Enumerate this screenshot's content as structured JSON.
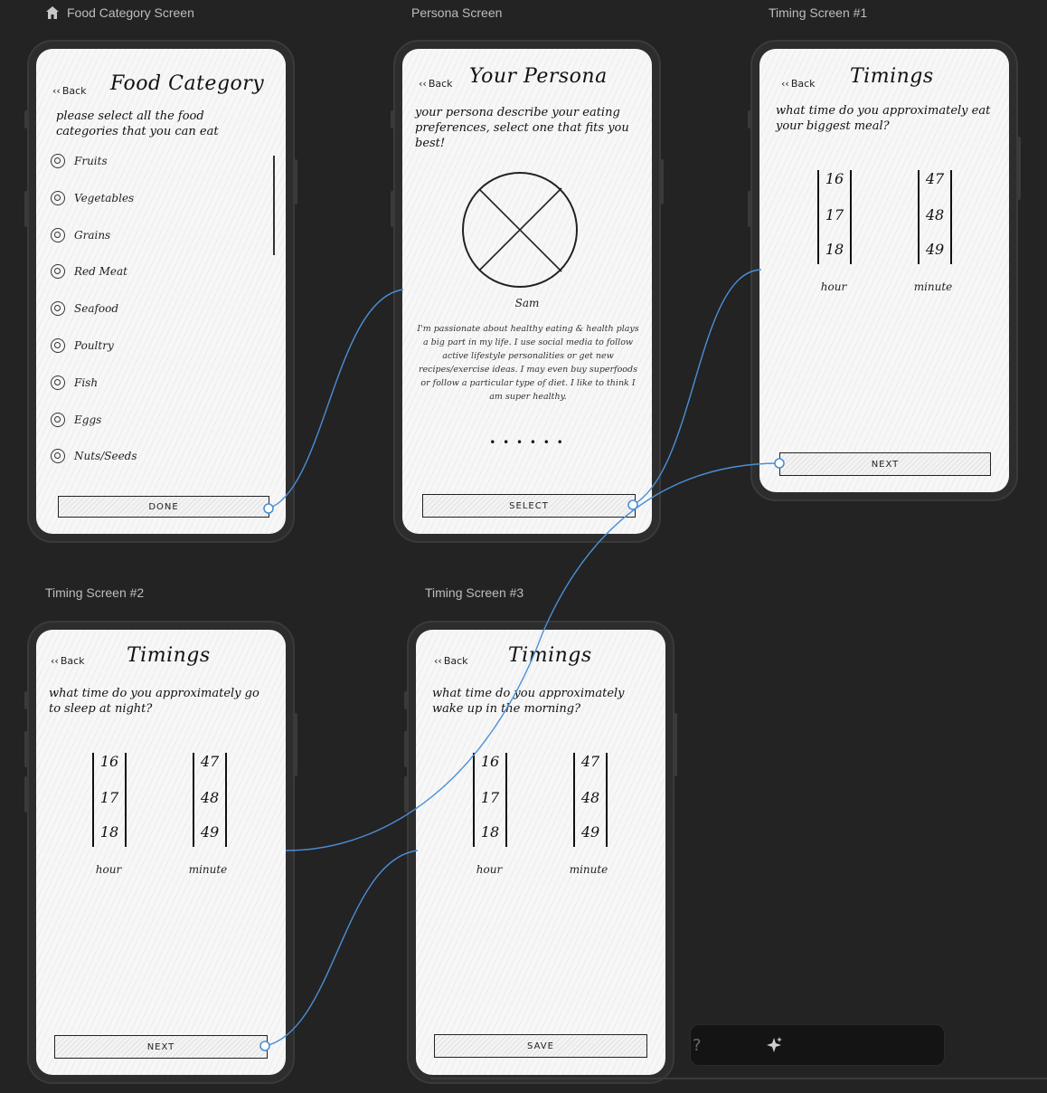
{
  "frames": {
    "food_category": "Food Category Screen",
    "persona": "Persona Screen",
    "timing1": "Timing Screen #1",
    "timing2": "Timing Screen #2",
    "timing3": "Timing Screen #3"
  },
  "food_category": {
    "back": "Back",
    "title": "Food Category",
    "prompt": "please select all the food categories that you can eat",
    "items": [
      "Fruits",
      "Vegetables",
      "Grains",
      "Red Meat",
      "Seafood",
      "Poultry",
      "Fish",
      "Eggs",
      "Nuts/Seeds"
    ],
    "button": "DONE"
  },
  "persona": {
    "back": "Back",
    "title": "Your Persona",
    "prompt": "your persona describe your eating preferences, select one that fits you best!",
    "name": "Sam",
    "description": "I'm passionate about healthy eating & health plays a big part in my life. I use social media to follow active lifestyle personalities or get new recipes/exercise ideas. I may even buy superfoods or follow a particular type of diet. I like to think I am super healthy.",
    "dots": "• • • • • •",
    "button": "SELECT"
  },
  "timing1": {
    "back": "Back",
    "title": "Timings",
    "prompt": "what time do you approximately eat your biggest meal?",
    "hours": [
      "16",
      "17",
      "18"
    ],
    "minutes": [
      "47",
      "48",
      "49"
    ],
    "hour_label": "hour",
    "minute_label": "minute",
    "button": "NEXT"
  },
  "timing2": {
    "back": "Back",
    "title": "Timings",
    "prompt": "what time do you approximately go to sleep at night?",
    "hours": [
      "16",
      "17",
      "18"
    ],
    "minutes": [
      "47",
      "48",
      "49"
    ],
    "hour_label": "hour",
    "minute_label": "minute",
    "button": "NEXT"
  },
  "timing3": {
    "back": "Back",
    "title": "Timings",
    "prompt": "what time do you approximately wake up in the morning?",
    "hours": [
      "16",
      "17",
      "18"
    ],
    "minutes": [
      "47",
      "48",
      "49"
    ],
    "hour_label": "hour",
    "minute_label": "minute",
    "button": "SAVE"
  },
  "ai_bar": {
    "hint": "?",
    "icon": "sparkle-icon"
  },
  "colors": {
    "canvas": "#232323",
    "connector": "#4a8fd6",
    "screen": "#f7f7f7"
  }
}
